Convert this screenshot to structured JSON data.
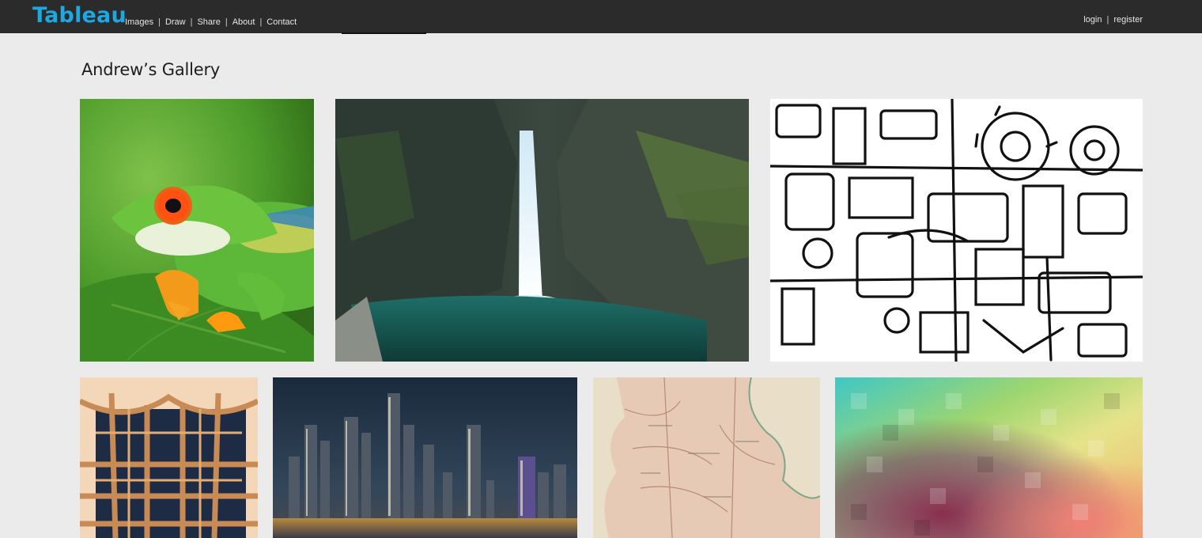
{
  "header": {
    "logo": "Tableau",
    "nav": [
      {
        "label": "Images"
      },
      {
        "label": "Draw"
      },
      {
        "label": "Share"
      },
      {
        "label": "About"
      },
      {
        "label": "Contact"
      }
    ],
    "nav_separator": "|",
    "login_label": "login",
    "register_label": "register"
  },
  "gallery": {
    "title": "Andrew’s Gallery",
    "images": [
      {
        "subject": "red-eyed tree frog on leaf"
      },
      {
        "subject": "waterfall in rocky gorge"
      },
      {
        "subject": "black and white doodle line art"
      },
      {
        "subject": "wooden shelving sculpture"
      },
      {
        "subject": "city skyline at night"
      },
      {
        "subject": "antique map"
      },
      {
        "subject": "colorful pixelated gradient"
      }
    ]
  },
  "colors": {
    "topbar": "#2b2b2b",
    "logo": "#1ea7e0",
    "background": "#ebebeb"
  }
}
